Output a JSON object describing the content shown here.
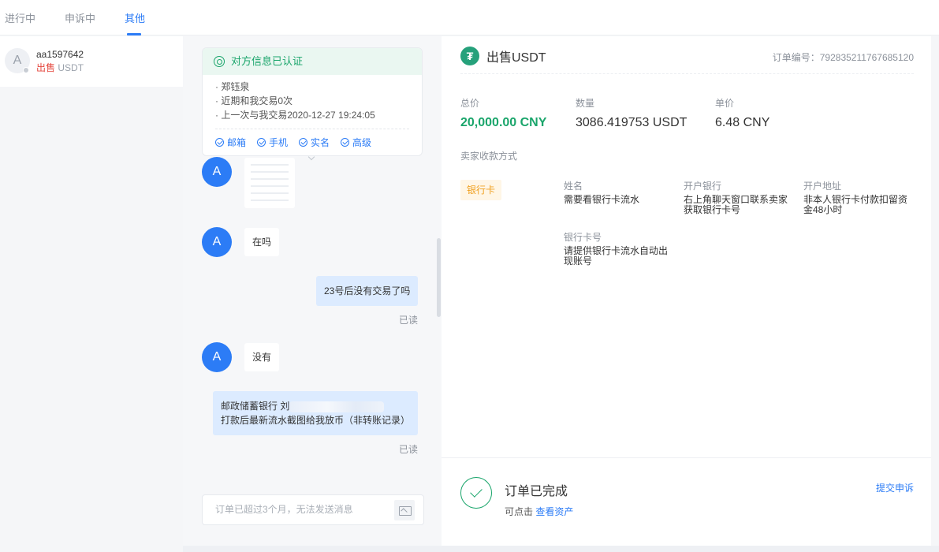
{
  "tabs": [
    {
      "label": "进行中"
    },
    {
      "label": "申诉中"
    },
    {
      "label": "其他"
    }
  ],
  "contact": {
    "avatar_letter": "A",
    "name": "aa1597642",
    "side": "出售",
    "coin": "USDT"
  },
  "verify": {
    "title": "对方信息已认证",
    "lines": [
      "· 郑钰泉",
      "· 近期和我交易0次",
      "· 上一次与我交易2020-12-27 19:24:05"
    ],
    "tags": [
      "邮箱",
      "手机",
      "实名",
      "高级"
    ]
  },
  "messages": {
    "avatar_letter": "A",
    "m1": "在吗",
    "m2": "23号后没有交易了吗",
    "read1": "已读",
    "m3": "没有",
    "m4_line1": "邮政储蓄银行 刘",
    "m4_line2": "打款后最新流水截图给我放币（非转账记录）",
    "read2": "已读"
  },
  "input": {
    "placeholder": "订单已超过3个月，无法发送消息"
  },
  "order": {
    "coin_icon": "₮",
    "title": "出售USDT",
    "order_no_label": "订单编号：",
    "order_no": "792835211767685120",
    "total_label": "总价",
    "total": "20,000.00 CNY",
    "qty_label": "数量",
    "qty": "3086.419753 USDT",
    "price_label": "单价",
    "price": "6.48 CNY",
    "pay_title": "卖家收款方式",
    "bank_tag": "银行卡",
    "fields": {
      "name_label": "姓名",
      "name": "需要看银行卡流水",
      "bank_label": "开户银行",
      "bank": "右上角聊天窗口联系卖家获取银行卡号",
      "addr_label": "开户地址",
      "addr": "非本人银行卡付款扣留资金48小时",
      "card_label": "银行卡号",
      "card": "请提供银行卡流水自动出现账号"
    },
    "status_title": "订单已完成",
    "status_sub": "可点击",
    "status_link": "查看资产",
    "appeal": "提交申诉"
  },
  "colors": {
    "accent": "#2c7cf6",
    "success": "#1aa56b",
    "sell": "#e5483f",
    "tag_orange": "#f0a020"
  },
  "icons": [
    "verified-icon",
    "check-circle-icon",
    "usdt-icon",
    "image-icon",
    "success-check-icon"
  ]
}
